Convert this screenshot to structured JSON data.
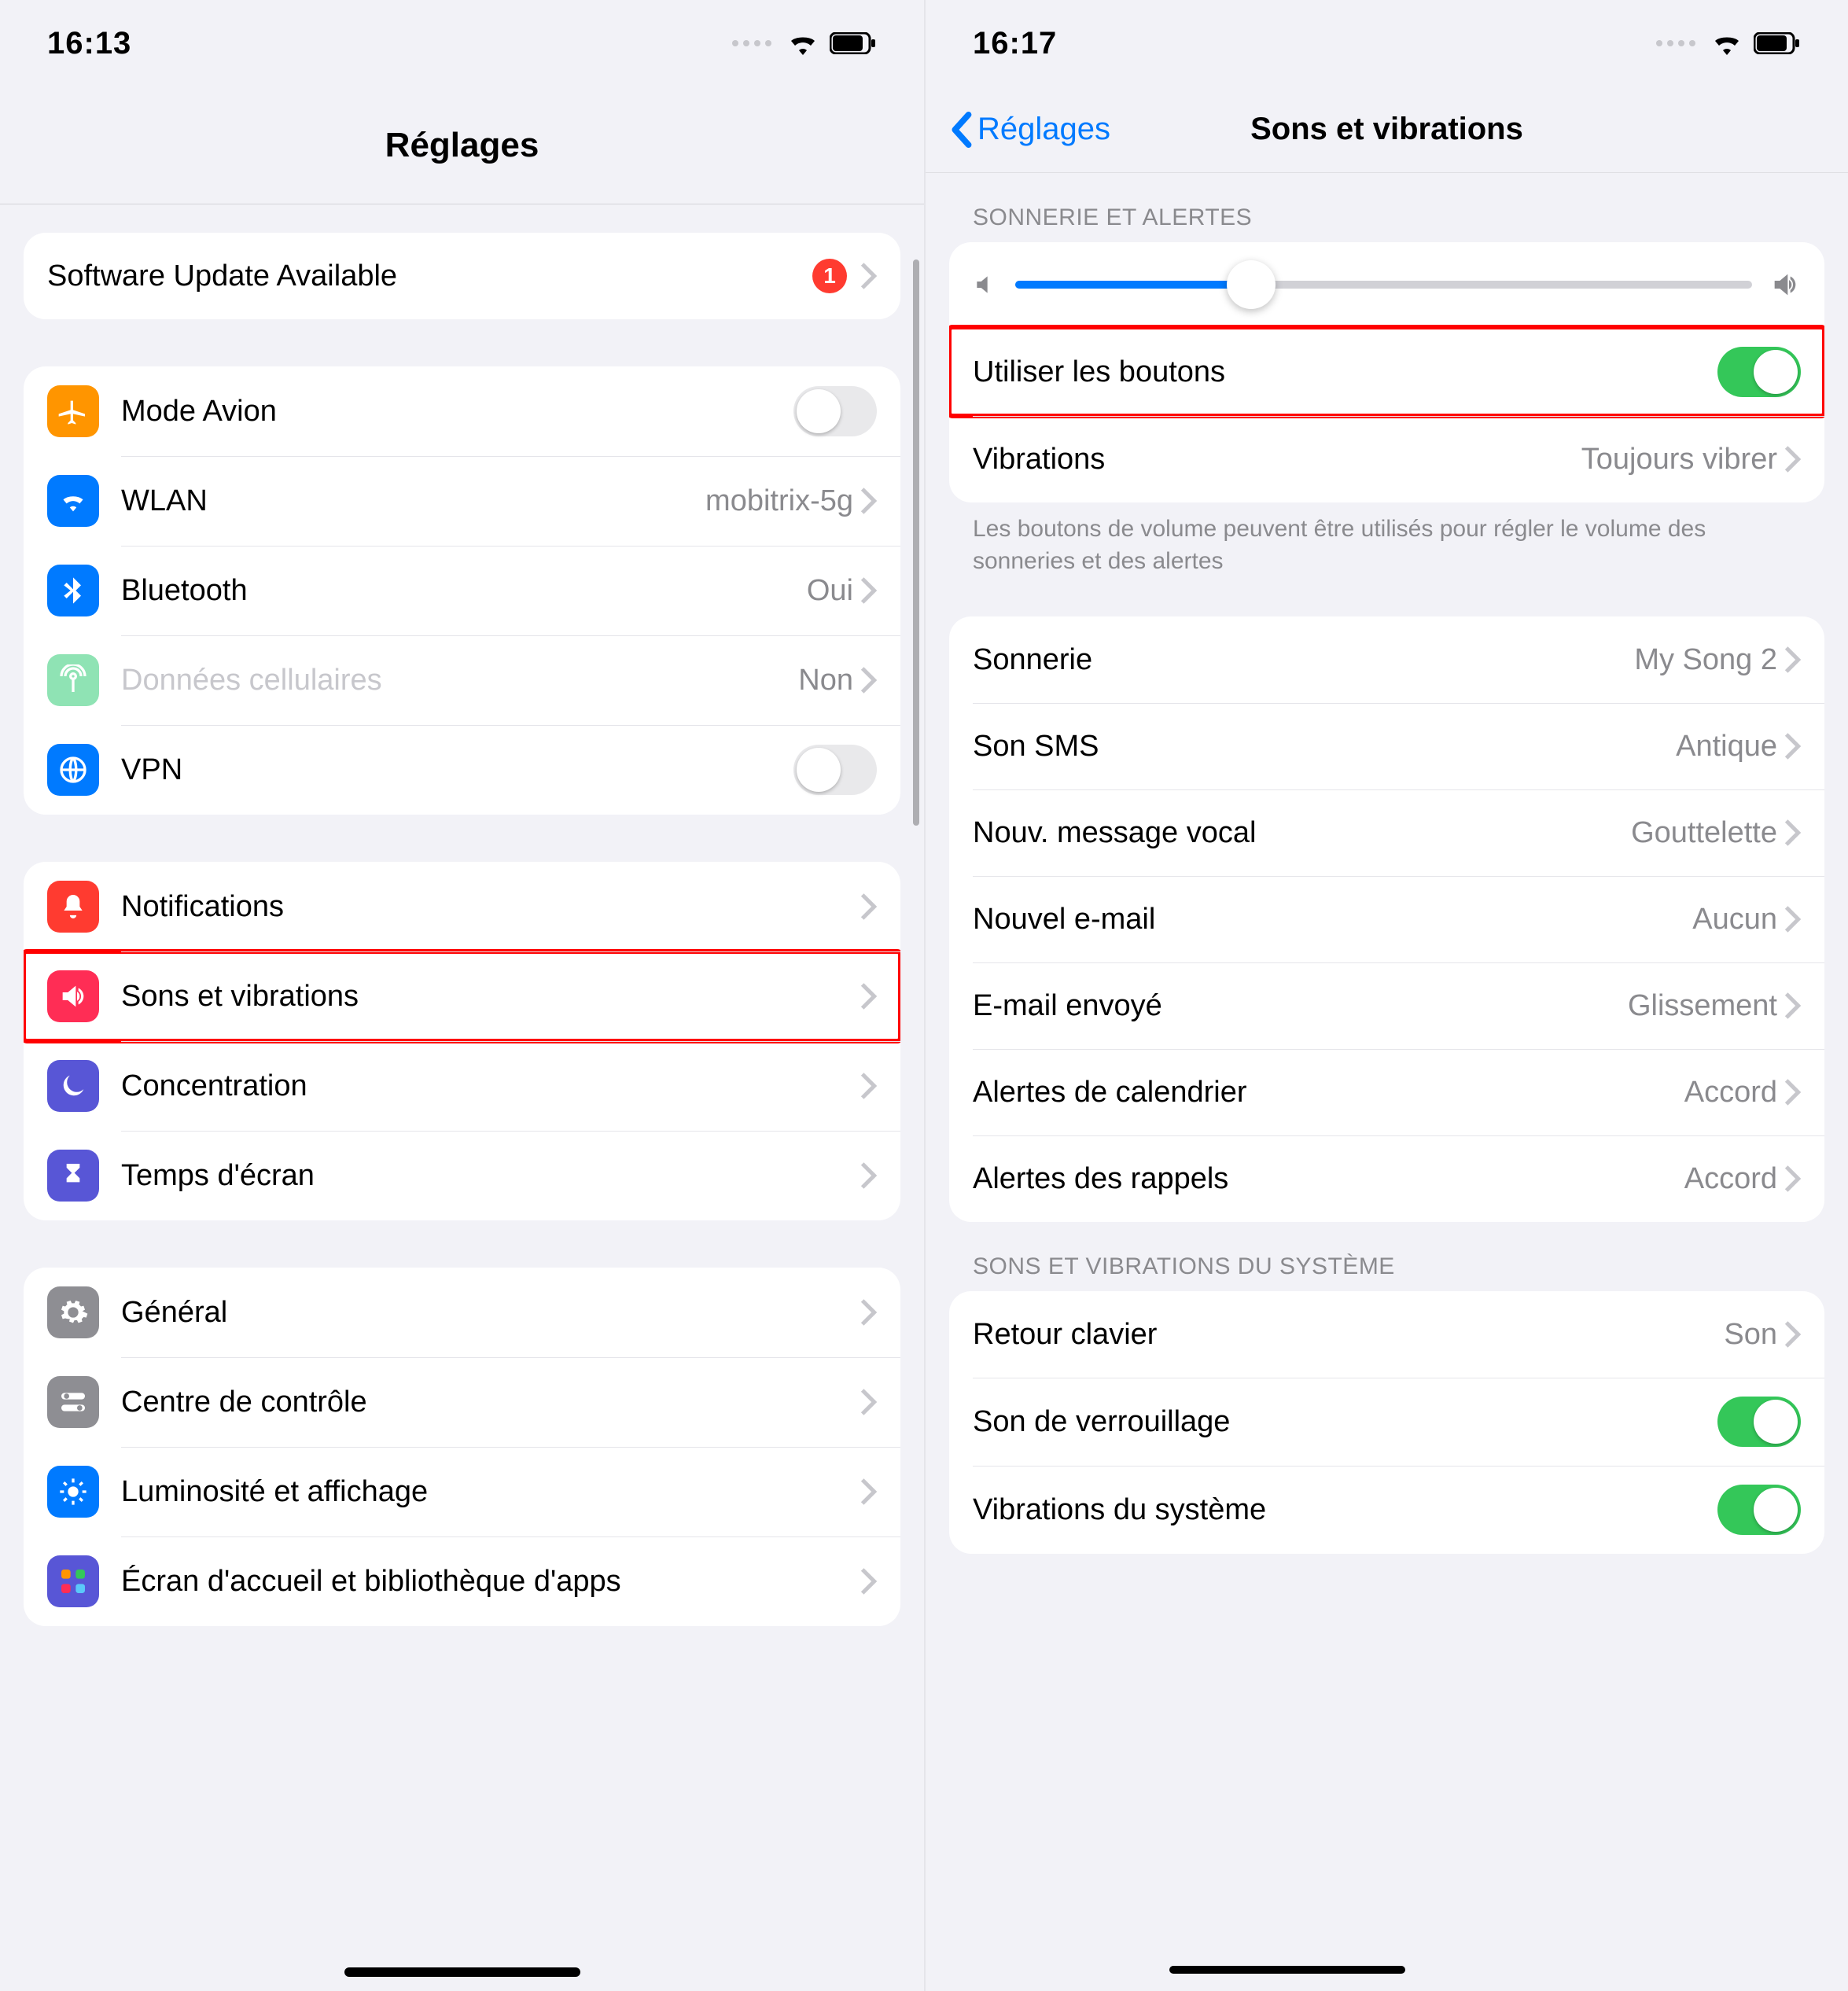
{
  "left": {
    "status": {
      "time": "16:13"
    },
    "title": "Réglages",
    "update": {
      "label": "Software Update Available",
      "badge": "1"
    },
    "network": [
      {
        "key": "airplane",
        "label": "Mode Avion",
        "toggle": false
      },
      {
        "key": "wlan",
        "label": "WLAN",
        "value": "mobitrix-5g"
      },
      {
        "key": "bluetooth",
        "label": "Bluetooth",
        "value": "Oui"
      },
      {
        "key": "cellular",
        "label": "Données cellulaires",
        "value": "Non",
        "disabled": true
      },
      {
        "key": "vpn",
        "label": "VPN",
        "toggle": false
      }
    ],
    "pref": [
      {
        "key": "notifications",
        "label": "Notifications"
      },
      {
        "key": "sounds",
        "label": "Sons et vibrations",
        "highlight": true
      },
      {
        "key": "focus",
        "label": "Concentration"
      },
      {
        "key": "screentime",
        "label": "Temps d'écran"
      }
    ],
    "general": [
      {
        "key": "general",
        "label": "Général"
      },
      {
        "key": "control",
        "label": "Centre de contrôle"
      },
      {
        "key": "display",
        "label": "Luminosité et affichage"
      },
      {
        "key": "home",
        "label": "Écran d'accueil et bibliothèque d'apps"
      }
    ]
  },
  "right": {
    "status": {
      "time": "16:17"
    },
    "back": "Réglages",
    "title": "Sons et vibrations",
    "section1_header": "SONNERIE ET ALERTES",
    "slider_percent": 32,
    "rows1": [
      {
        "key": "buttons",
        "label": "Utiliser les boutons",
        "toggle": true,
        "highlight": true
      },
      {
        "key": "vibration",
        "label": "Vibrations",
        "value": "Toujours vibrer"
      }
    ],
    "section1_footer": "Les boutons de volume peuvent être utilisés pour régler le volume des sonneries et des alertes",
    "rows2": [
      {
        "key": "ringtone",
        "label": "Sonnerie",
        "value": "My Song 2"
      },
      {
        "key": "sms",
        "label": "Son SMS",
        "value": "Antique"
      },
      {
        "key": "voicemail",
        "label": "Nouv. message vocal",
        "value": "Gouttelette"
      },
      {
        "key": "email",
        "label": "Nouvel e-mail",
        "value": "Aucun"
      },
      {
        "key": "sentmail",
        "label": "E-mail envoyé",
        "value": "Glissement"
      },
      {
        "key": "calendar",
        "label": "Alertes de calendrier",
        "value": "Accord"
      },
      {
        "key": "reminders",
        "label": "Alertes des rappels",
        "value": "Accord"
      }
    ],
    "section3_header": "SONS ET VIBRATIONS DU SYSTÈME",
    "rows3": [
      {
        "key": "keyboard",
        "label": "Retour clavier",
        "value": "Son"
      },
      {
        "key": "lock",
        "label": "Son de verrouillage",
        "toggle": true
      },
      {
        "key": "sysvib",
        "label": "Vibrations du système",
        "toggle": true
      }
    ]
  }
}
